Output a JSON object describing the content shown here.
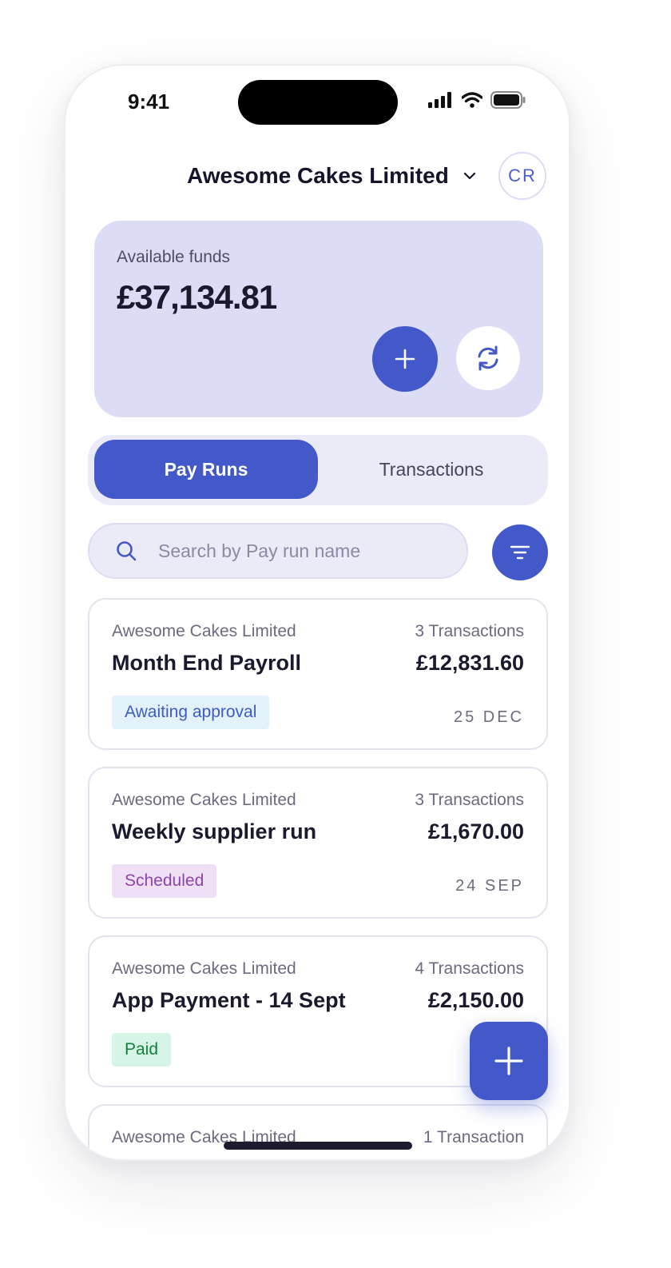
{
  "status_bar": {
    "time": "9:41"
  },
  "header": {
    "company": "Awesome Cakes Limited",
    "avatar_initials": "CR"
  },
  "funds": {
    "label": "Available funds",
    "amount": "£37,134.81"
  },
  "tabs": [
    {
      "label": "Pay Runs",
      "active": true
    },
    {
      "label": "Transactions",
      "active": false
    }
  ],
  "search": {
    "placeholder": "Search by Pay run name"
  },
  "pay_runs": [
    {
      "company": "Awesome Cakes Limited",
      "name": "Month End Payroll",
      "transactions": "3 Transactions",
      "amount": "£12,831.60",
      "status": "Awaiting approval",
      "date": "25 DEC"
    },
    {
      "company": "Awesome Cakes Limited",
      "name": "Weekly supplier run",
      "transactions": "3 Transactions",
      "amount": "£1,670.00",
      "status": "Scheduled",
      "date": "24 SEP"
    },
    {
      "company": "Awesome Cakes Limited",
      "name": "App Payment - 14 Sept",
      "transactions": "4 Transactions",
      "amount": "£2,150.00",
      "status": "Paid",
      "date": ""
    },
    {
      "company": "Awesome Cakes Limited",
      "name": "",
      "transactions": "1 Transaction",
      "amount": "",
      "status": "",
      "date": ""
    }
  ],
  "colors": {
    "accent": "#4359c9",
    "funds_bg": "#dcdcf6",
    "badge_awaiting_bg": "#e3f1fb",
    "badge_awaiting_text": "#3f5bc4",
    "badge_scheduled_bg": "#efe0f6",
    "badge_scheduled_text": "#8e44ad",
    "badge_paid_bg": "#d6f5e6",
    "badge_paid_text": "#15803d"
  },
  "icons": [
    "signal-icon",
    "wifi-icon",
    "battery-icon",
    "chevron-down-icon",
    "plus-icon",
    "refresh-icon",
    "search-icon",
    "filter-icon"
  ]
}
